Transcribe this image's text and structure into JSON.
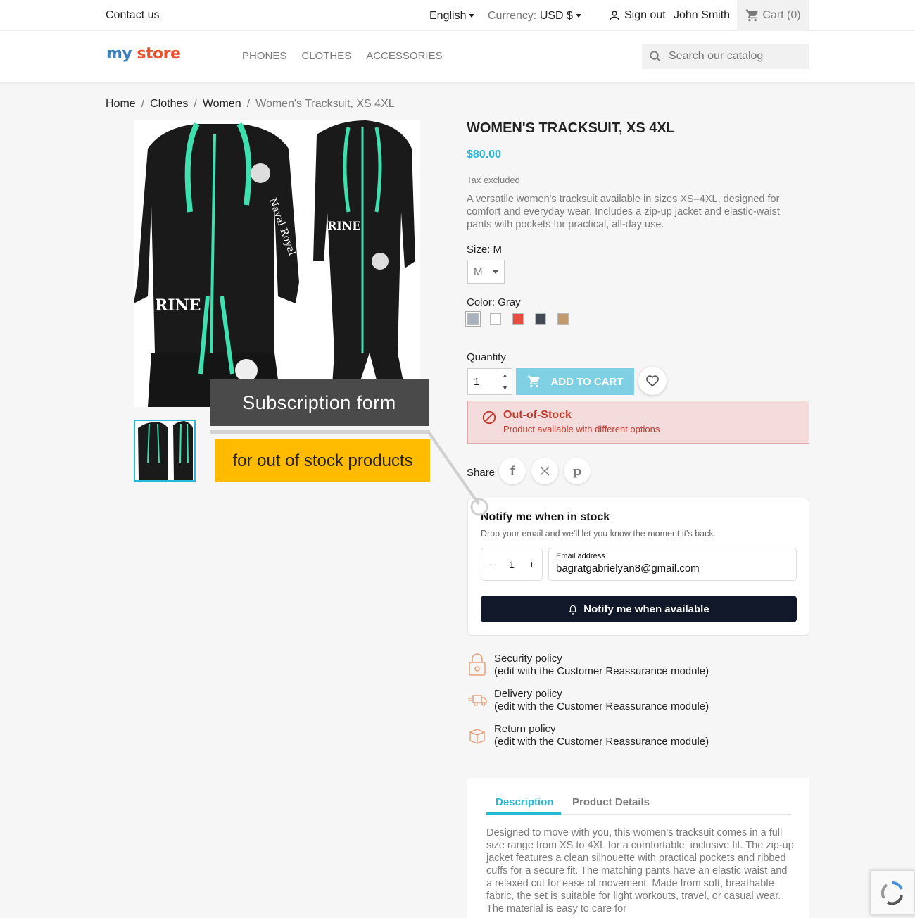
{
  "topbar": {
    "contact": "Contact us",
    "language": "English",
    "currency_label": "Currency:",
    "currency_value": "USD $",
    "signout": "Sign out",
    "username": "John Smith",
    "cart": "Cart (0)"
  },
  "header": {
    "logo_my": "my",
    "logo_store": "store",
    "nav": [
      "PHONES",
      "CLOTHES",
      "ACCESSORIES"
    ],
    "search_placeholder": "Search our catalog"
  },
  "breadcrumb": [
    "Home",
    "Clothes",
    "Women",
    "Women's Tracksuit, XS 4XL"
  ],
  "annotations": {
    "label1": "Subscription form",
    "label2": "for out of stock products"
  },
  "product": {
    "title": "WOMEN'S TRACKSUIT, XS 4XL",
    "price": "$80.00",
    "tax": "Tax excluded",
    "description": "A versatile women's tracksuit available in sizes XS–4XL, designed for comfort and everyday wear. Includes a zip-up jacket and elastic-waist pants with pockets for practical, all-day use.",
    "size_label": "Size: M",
    "size_value": "M",
    "color_label": "Color: Gray",
    "colors": [
      "#aab2bd",
      "#ffffff",
      "#e84c3d",
      "#434a54",
      "#c19a6b"
    ],
    "quantity_label": "Quantity",
    "quantity_value": "1",
    "add_to_cart": "ADD TO CART",
    "oos_title": "Out-of-Stock",
    "oos_sub": "Product available with different options",
    "share_label": "Share"
  },
  "notify": {
    "heading": "Notify me when in stock",
    "sub": "Drop your email and we'll let you know the moment it's back.",
    "qty": "1",
    "minus": "−",
    "plus": "+",
    "email_label": "Email address",
    "email_value": "bagratgabrielyan8@gmail.com",
    "button": "Notify me when available"
  },
  "reassurance": [
    {
      "title": "Security policy",
      "sub": "(edit with the Customer Reassurance module)",
      "icon": "lock-icon"
    },
    {
      "title": "Delivery policy",
      "sub": "(edit with the Customer Reassurance module)",
      "icon": "truck-icon"
    },
    {
      "title": "Return policy",
      "sub": "(edit with the Customer Reassurance module)",
      "icon": "box-icon"
    }
  ],
  "tabs": {
    "description": "Description",
    "details": "Product Details",
    "body": "Designed to move with you, this women's tracksuit comes in a full size range from XS to 4XL for a comfortable, inclusive fit. The zip-up jacket features a clean silhouette with practical pockets and ribbed cuffs for a secure fit. The matching pants have an elastic waist and a relaxed cut for ease of movement. Made from soft, breathable fabric, the set is suitable for light workouts, travel, or casual wear. The material is easy to care for"
  },
  "colors": {
    "accent": "#24b9d7",
    "danger": "#c0392b",
    "dark_button": "#10182a"
  }
}
